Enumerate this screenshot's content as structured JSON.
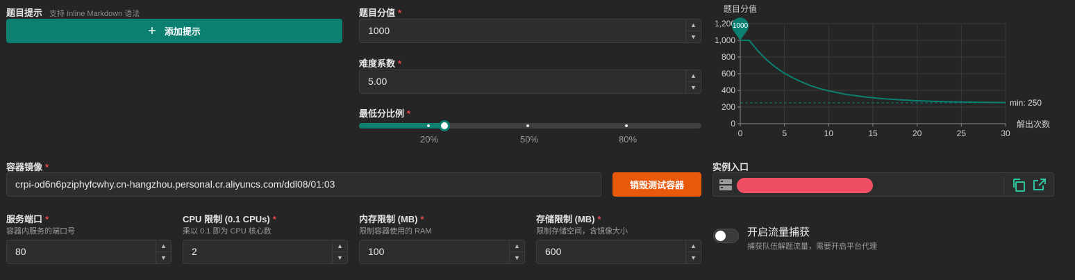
{
  "hint": {
    "label": "题目提示",
    "sublabel": "支持 Inline Markdown 语法",
    "add_button": "添加提示"
  },
  "score": {
    "label": "题目分值",
    "value": "1000"
  },
  "difficulty": {
    "label": "难度系数",
    "value": "5.00"
  },
  "min_ratio": {
    "label": "最低分比例",
    "marks": [
      "20%",
      "50%",
      "80%"
    ],
    "value_fraction": 0.25
  },
  "chart_data": {
    "type": "line",
    "title": "题目分值",
    "xlabel": "解出次数",
    "ylabel": "",
    "xlim": [
      0,
      30
    ],
    "ylim": [
      0,
      1200
    ],
    "x_ticks": [
      "0",
      "5",
      "10",
      "15",
      "20",
      "25",
      "30"
    ],
    "y_ticks": [
      "0",
      "200",
      "400",
      "600",
      "800",
      "1,000",
      "1,200"
    ],
    "series": [
      {
        "x": [
          0,
          1,
          2,
          3,
          4,
          5,
          6,
          7,
          8,
          9,
          10,
          12,
          14,
          16,
          18,
          20,
          22,
          24,
          26,
          28,
          30
        ],
        "values": [
          1000,
          1000,
          872,
          763,
          676,
          604,
          547,
          497,
          455,
          420,
          394,
          350,
          322,
          300,
          286,
          275,
          268,
          262,
          258,
          255,
          253
        ]
      }
    ],
    "marker": {
      "x": 0,
      "label": "1000"
    },
    "min_line": {
      "y": 250,
      "label": "min: 250"
    },
    "colors": {
      "line": "#0b8071",
      "grid": "#3a3a3a"
    }
  },
  "image": {
    "label": "容器镜像",
    "value": "crpi-od6n6pziphyfcwhy.cn-hangzhou.personal.cr.aliyuncs.com/ddl08/01:03",
    "destroy_button": "销毁测试容器"
  },
  "entry": {
    "label": "实例入口"
  },
  "port": {
    "label": "服务端口",
    "sub": "容器内服务的端口号",
    "value": "80"
  },
  "cpu": {
    "label": "CPU 限制 (0.1 CPUs)",
    "sub": "乘以 0.1 即为 CPU 核心数",
    "value": "2"
  },
  "memory": {
    "label": "内存限制 (MB)",
    "sub": "限制容器使用的 RAM",
    "value": "100"
  },
  "storage": {
    "label": "存储限制 (MB)",
    "sub": "限制存储空间，含镜像大小",
    "value": "600"
  },
  "capture": {
    "label": "开启流量捕获",
    "sub": "捕获队伍解题流量，需要开启平台代理",
    "enabled": false
  },
  "required_mark": "*",
  "colors": {
    "accent": "#0b8071",
    "danger": "#e8590c",
    "required": "#e5484d"
  }
}
